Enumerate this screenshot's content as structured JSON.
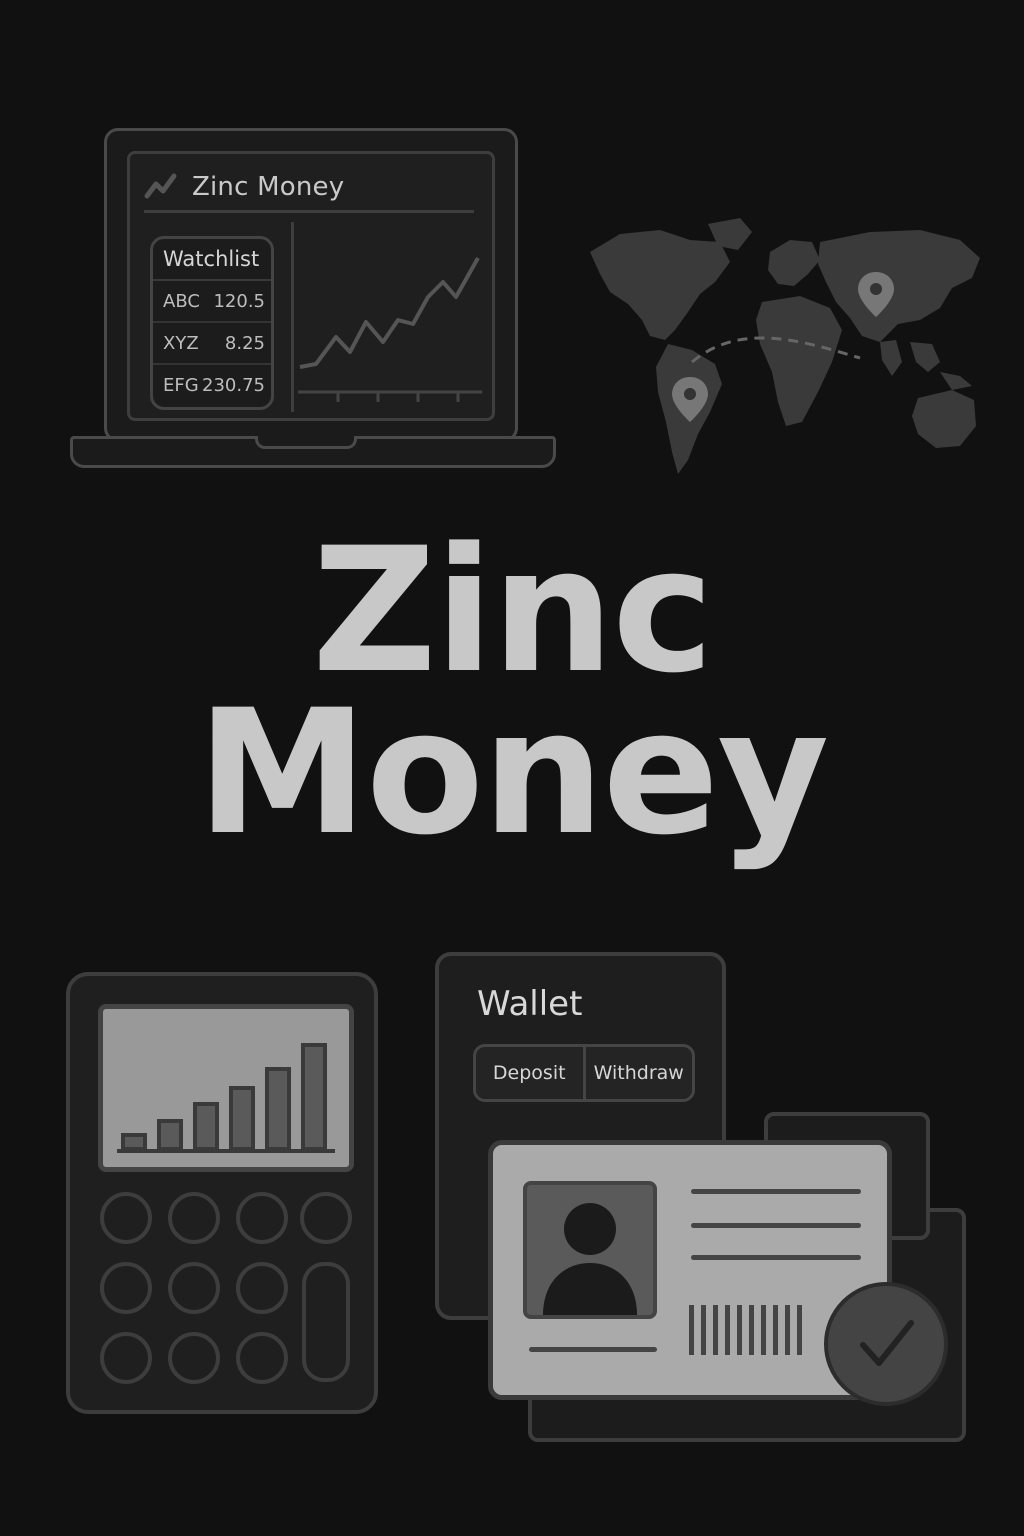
{
  "app": {
    "title": "Zinc Money",
    "hero_line1": "Zinc",
    "hero_line2": "Money"
  },
  "laptop": {
    "app_name": "Zinc Money",
    "logo_icon": "trend-line-icon",
    "watchlist": {
      "title": "Watchlist",
      "rows": [
        {
          "symbol": "ABC",
          "price": "120.5"
        },
        {
          "symbol": "XYZ",
          "price": "8.25"
        },
        {
          "symbol": "EFG",
          "price": "230.75"
        }
      ]
    },
    "chart_icon": "line-chart-rising"
  },
  "world_map": {
    "icon": "world-map",
    "pins": [
      "location-pin-icon",
      "location-pin-icon"
    ]
  },
  "calculator": {
    "icon": "calculator-with-bar-chart",
    "bar_levels": [
      0.12,
      0.24,
      0.38,
      0.52,
      0.68,
      0.88
    ]
  },
  "wallet": {
    "title": "Wallet",
    "deposit_label": "Deposit",
    "withdraw_label": "Withdraw"
  },
  "id_card": {
    "icon": "identity-card",
    "badge_icon": "checkmark-icon"
  },
  "colors": {
    "background": "#111111",
    "text": "#c8c8c8",
    "outline": "#3d3d3d"
  }
}
